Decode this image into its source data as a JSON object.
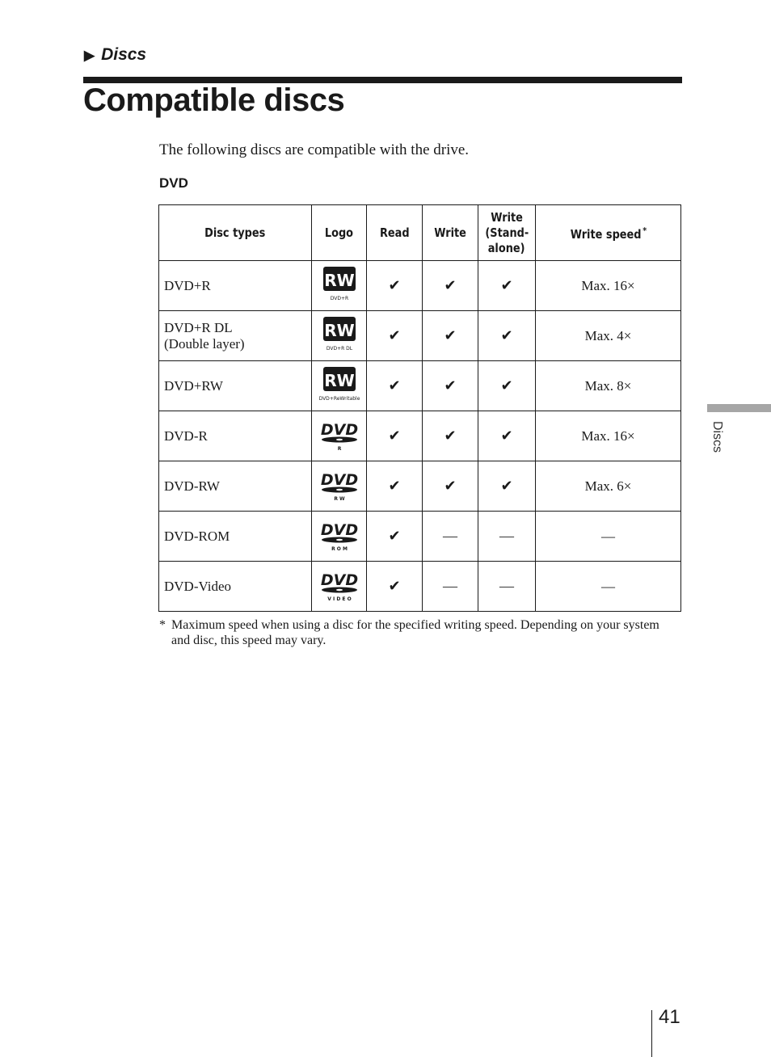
{
  "header": {
    "section_marker": "▶",
    "section": "Discs",
    "title": "Compatible discs"
  },
  "intro": "The following discs are compatible with the drive.",
  "dvd": {
    "heading": "DVD",
    "columns": {
      "disc_types": "Disc types",
      "logo": "Logo",
      "read": "Read",
      "write": "Write",
      "write_standalone_1": "Write",
      "write_standalone_2": "(Stand-",
      "write_standalone_3": "alone)",
      "write_speed": "Write speed",
      "write_speed_note": "*"
    },
    "rows": [
      {
        "type": "DVD+R",
        "type2": "",
        "logo": "RW",
        "logo_caption": "DVD+R",
        "read": "✔",
        "write": "✔",
        "standalone": "✔",
        "speed": "Max. 16×"
      },
      {
        "type": "DVD+R DL",
        "type2": "(Double layer)",
        "logo": "RW",
        "logo_caption": "DVD+R DL",
        "read": "✔",
        "write": "✔",
        "standalone": "✔",
        "speed": "Max. 4×"
      },
      {
        "type": "DVD+RW",
        "type2": "",
        "logo": "RW",
        "logo_caption": "DVD+ReWritable",
        "read": "✔",
        "write": "✔",
        "standalone": "✔",
        "speed": "Max. 8×"
      },
      {
        "type": "DVD-R",
        "type2": "",
        "logo": "DVD",
        "logo_caption": "R",
        "read": "✔",
        "write": "✔",
        "standalone": "✔",
        "speed": "Max. 16×"
      },
      {
        "type": "DVD-RW",
        "type2": "",
        "logo": "DVD",
        "logo_caption": "R W",
        "read": "✔",
        "write": "✔",
        "standalone": "✔",
        "speed": "Max. 6×"
      },
      {
        "type": "DVD-ROM",
        "type2": "",
        "logo": "DVD",
        "logo_caption": "R O M",
        "read": "✔",
        "write": "—",
        "standalone": "—",
        "speed": "—"
      },
      {
        "type": "DVD-Video",
        "type2": "",
        "logo": "DVD",
        "logo_caption": "V I D E O",
        "read": "✔",
        "write": "—",
        "standalone": "—",
        "speed": "—"
      }
    ]
  },
  "footnote": {
    "mark": "*",
    "text": "Maximum speed when using a disc for the specified writing speed. Depending on your system and disc, this speed may vary."
  },
  "side_tab": "Discs",
  "page_number": "41"
}
